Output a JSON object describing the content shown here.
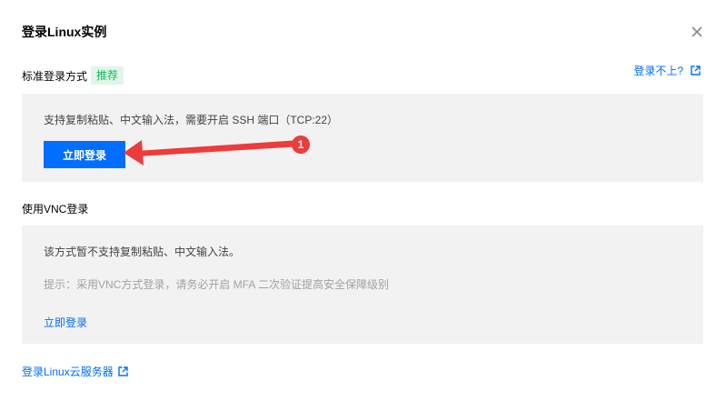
{
  "dialog": {
    "title": "登录Linux实例",
    "close_icon": "close-icon"
  },
  "standard": {
    "heading": "标准登录方式",
    "badge": "推荐",
    "help_link": "登录不上?",
    "description": "支持复制粘贴、中文输入法，需要开启 SSH 端口（TCP:22）",
    "login_button": "立即登录"
  },
  "vnc": {
    "heading": "使用VNC登录",
    "description": "该方式暂不支持复制粘贴、中文输入法。",
    "hint": "提示：采用VNC方式登录，请务必开启 MFA 二次验证提高安全保障级别",
    "login_link": "立即登录"
  },
  "footer": {
    "link": "登录Linux云服务器"
  },
  "annotation": {
    "step_number": "1",
    "color": "#ee3b3b"
  },
  "colors": {
    "accent": "#006eff",
    "badge_text": "#0abf5b",
    "badge_bg": "#e3f4ea",
    "panel_bg": "#f2f2f2"
  }
}
